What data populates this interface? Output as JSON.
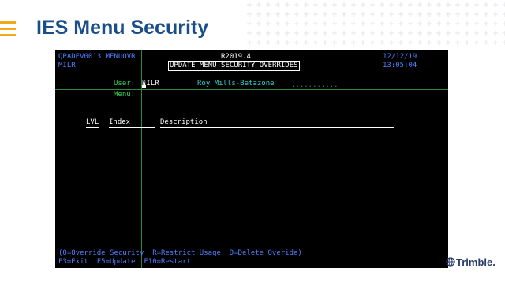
{
  "slide": {
    "title": "IES Menu Security",
    "menu_icon": "hamburger-menu-icon",
    "accent_color": "#f2a91b",
    "title_color": "#1a4e8a",
    "brand": "Trimble.",
    "brand_icon": "trimble-globe-icon"
  },
  "terminal": {
    "program": "QPADEV0013 MENUOVR",
    "user_id": "MILR",
    "version": "R2019.4",
    "screen_title": "UPDATE MENU SECURITY OVERRIDES",
    "date": "12/12/19",
    "time": "13:05:04",
    "user_label": "User:",
    "user_value": "MILR",
    "user_name": "Roy Mills-Betazone",
    "user_name_fill": "...........",
    "menu_label": "Menu:",
    "menu_value": "",
    "columns": [
      "LVL",
      "Index",
      "Description"
    ],
    "legend": "(O=Override Security  R=Restrict Usage  D=Delete Overide)",
    "function_keys": "F3=Exit  F5=Update  F10=Restart"
  }
}
